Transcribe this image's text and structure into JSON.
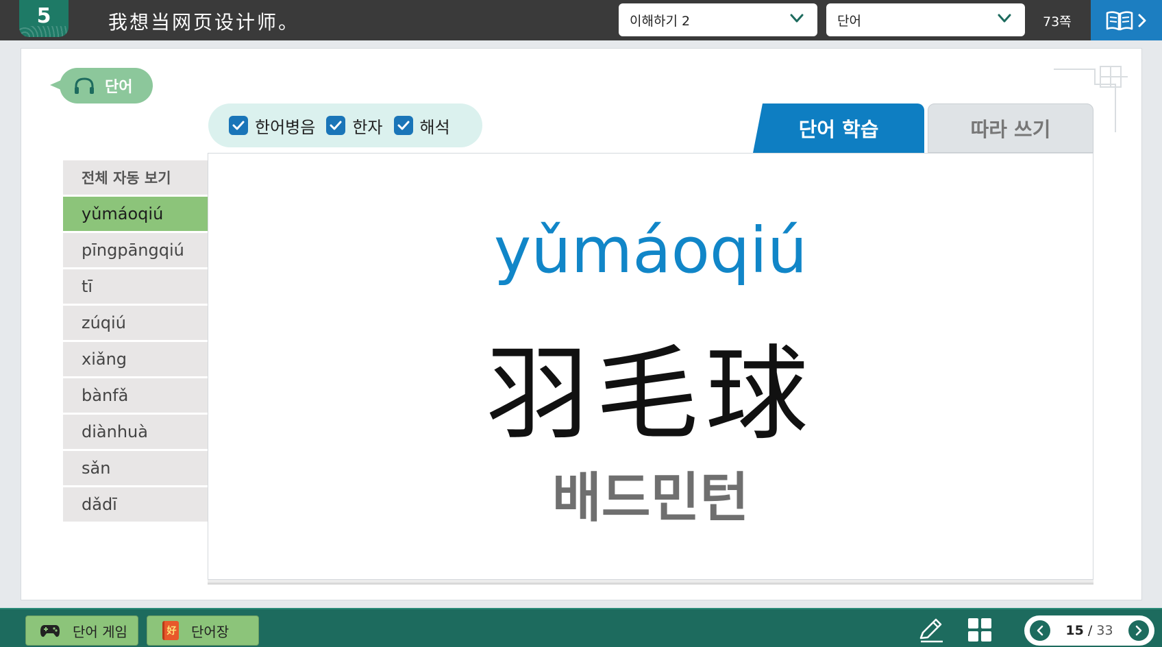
{
  "header": {
    "lesson_number": "5",
    "lesson_title": "我想当网页设计师。",
    "section_select": "이해하기 2",
    "mode_select": "단어",
    "page_label": "73쪽"
  },
  "section_pill": "단어",
  "toggles": [
    {
      "label": "한어병음",
      "checked": true
    },
    {
      "label": "한자",
      "checked": true
    },
    {
      "label": "해석",
      "checked": true
    }
  ],
  "tabs": {
    "study": "단어 학습",
    "write": "따라 쓰기"
  },
  "word_list": {
    "auto_view": "전체 자동 보기",
    "items": [
      "yǔmáoqiú",
      "pīngpāngqiú",
      "tī",
      "zúqiú",
      "xiǎng",
      "bànfǎ",
      "diànhuà",
      "sǎn",
      "dǎdī"
    ],
    "active_index": 0
  },
  "card": {
    "pinyin": "yǔmáoqiú",
    "hanzi": "羽毛球",
    "meaning": "배드민턴"
  },
  "footer": {
    "game_label": "단어 게임",
    "vocab_label": "단어장",
    "vocab_icon_char": "好",
    "page_current": "15",
    "page_separator": "/",
    "page_total": "33"
  },
  "colors": {
    "accent_blue": "#0e7ec2",
    "green": "#8cc47a",
    "dark_green": "#1d6b5e"
  }
}
